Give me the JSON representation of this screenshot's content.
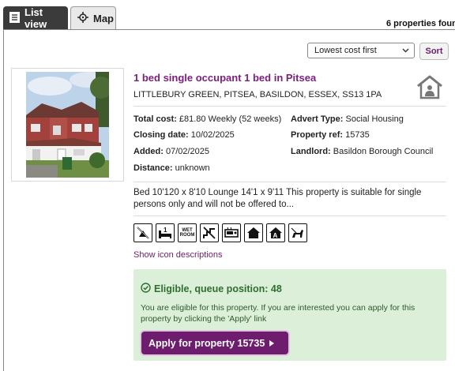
{
  "tabs": [
    {
      "label": "List view",
      "icon": "list-icon",
      "active": true
    },
    {
      "label": "Map",
      "icon": "crosshair-icon",
      "active": false
    }
  ],
  "results": {
    "count_label": "6 properties foun"
  },
  "sort": {
    "selected": "Lowest cost first",
    "button_label": "Sort"
  },
  "property": {
    "title": "1 bed single occupant 1 bed in Pitsea",
    "address": "LITTLEBURY GREEN, PITSEA, BASILDON, ESSEX, SS13 1PA",
    "total_cost_label": "Total cost:",
    "total_cost": "£81.80 Weekly (52 weeks)",
    "advert_type_label": "Advert Type:",
    "advert_type": "Social Housing",
    "closing_date_label": "Closing date:",
    "closing_date": "10/02/2025",
    "property_ref_label": "Property ref:",
    "property_ref": "15735",
    "added_label": "Added:",
    "added": "07/02/2025",
    "landlord_label": "Landlord:",
    "landlord": "Basildon Borough Council",
    "distance_label": "Distance:",
    "distance": "unknown",
    "description": "Bed 10'120 x 8'10 Lounge 14'1 x 9'11 This property is suitable for single persons only and will not be offered to...",
    "feature_icons": [
      {
        "name": "no-pets-icon",
        "text": ""
      },
      {
        "name": "one-bedroom-icon",
        "text": "1"
      },
      {
        "name": "wet-room-icon",
        "text": "WET ROOM"
      },
      {
        "name": "no-stairs-icon",
        "text": ""
      },
      {
        "name": "gas-heating-icon",
        "text": ""
      },
      {
        "name": "house-type-icon",
        "text": ""
      },
      {
        "name": "accessible-house-icon",
        "text": "A"
      },
      {
        "name": "dog-icon",
        "text": ""
      }
    ],
    "show_icons_label": "Show icon descriptions"
  },
  "eligibility": {
    "title": "Eligible, queue position: 48",
    "text": "You are eligible for this property. If you are interested you can apply for this property by clicking the 'Apply' link",
    "apply_label": "Apply for property 15735"
  },
  "colors": {
    "accent": "#7a1f7a",
    "button": "#6e1d6e",
    "eligible_bg": "#dcefd9",
    "eligible_text": "#2f6f2f",
    "tab_active": "#3b3b3b"
  }
}
